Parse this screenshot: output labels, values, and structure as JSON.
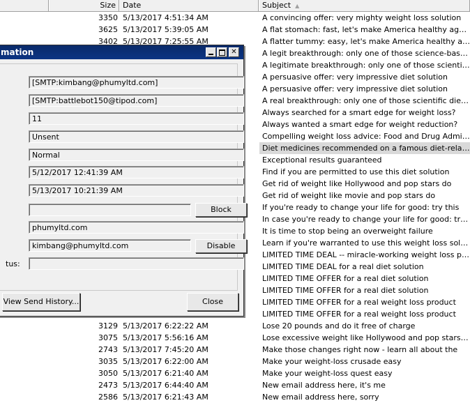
{
  "list": {
    "columns": {
      "size": "Size",
      "date": "Date",
      "subject": "Subject"
    },
    "rows": [
      {
        "size": "3350",
        "date": "5/13/2017 4:51:34 AM",
        "subject": "A convincing offer: very mighty weight loss solution"
      },
      {
        "size": "3625",
        "date": "5/13/2017 5:39:05 AM",
        "subject": "A flat stomach: fast, let's make America healthy again"
      },
      {
        "size": "3402",
        "date": "5/13/2017 7:25:55 AM",
        "subject": "A flatter tummy: easy, let's make America healthy again"
      },
      {
        "size": "",
        "date": "",
        "subject": "A legit breakthrough: only one of those science-based weig..."
      },
      {
        "size": "",
        "date": "",
        "subject": "A legitimate breakthrough: only one of those scientific dietary"
      },
      {
        "size": "",
        "date": "",
        "subject": "A persuasive offer: very impressive diet solution"
      },
      {
        "size": "",
        "date": "",
        "subject": "A persuasive offer: very impressive diet solution"
      },
      {
        "size": "",
        "date": "",
        "subject": "A real breakthrough: only one of those scientific dietary sol..."
      },
      {
        "size": "",
        "date": "",
        "subject": "Always searched for a smart edge for weight loss?"
      },
      {
        "size": "",
        "date": "",
        "subject": "Always wanted a smart edge for weight reduction?"
      },
      {
        "size": "",
        "date": "",
        "subject": "Compelling weight loss advice: Food and Drug Administration"
      },
      {
        "size": "",
        "date": "",
        "subject": "Diet medicines  recommended on a famous diet-related talk..."
      },
      {
        "size": "",
        "date": "",
        "subject": "Exceptional results guaranteed"
      },
      {
        "size": "",
        "date": "",
        "subject": "Find if you are permitted to use this diet solution"
      },
      {
        "size": "",
        "date": "",
        "subject": "Get rid of weight like Hollywood and pop stars do"
      },
      {
        "size": "",
        "date": "",
        "subject": "Get rid of weight like movie and pop stars do"
      },
      {
        "size": "",
        "date": "",
        "subject": "If you're ready to change your life for good: try this"
      },
      {
        "size": "",
        "date": "",
        "subject": "In case you're ready to change your life for good: try this"
      },
      {
        "size": "",
        "date": "",
        "subject": "It is time to stop being an overweight failure"
      },
      {
        "size": "",
        "date": "",
        "subject": "Learn if you're warranted to use this weight loss solution"
      },
      {
        "size": "",
        "date": "",
        "subject": "LIMITED TIME DEAL -- miracle-working weight loss pills"
      },
      {
        "size": "",
        "date": "",
        "subject": "LIMITED TIME DEAL for a real diet solution"
      },
      {
        "size": "",
        "date": "",
        "subject": "LIMITED TIME OFFER for a real diet solution"
      },
      {
        "size": "",
        "date": "",
        "subject": "LIMITED TIME OFFER for a real diet solution"
      },
      {
        "size": "",
        "date": "",
        "subject": "LIMITED TIME OFFER for a real weight loss product"
      },
      {
        "size": "",
        "date": "",
        "subject": "LIMITED TIME OFFER for a real weight loss product"
      },
      {
        "size": "3129",
        "date": "5/13/2017 6:22:22 AM",
        "subject": "Lose 20 pounds and do it free of charge"
      },
      {
        "size": "3075",
        "date": "5/13/2017 5:56:16 AM",
        "subject": "Lose excessive weight like Hollywood and pop stars do"
      },
      {
        "size": "2743",
        "date": "5/13/2017 7:45:20 AM",
        "subject": "Make those changes right now - learn all about the"
      },
      {
        "size": "3035",
        "date": "5/13/2017 6:22:00 AM",
        "subject": "Make your weight-loss crusade easy"
      },
      {
        "size": "3050",
        "date": "5/13/2017 6:21:40 AM",
        "subject": "Make your weight-loss quest easy"
      },
      {
        "size": "2473",
        "date": "5/13/2017 6:44:40 AM",
        "subject": "New email address here, it's me"
      },
      {
        "size": "2586",
        "date": "5/13/2017 6:21:43 AM",
        "subject": "New email address here, sorry"
      }
    ]
  },
  "dialog": {
    "title": "mation",
    "fields": {
      "from": "[SMTP:kimbang@phumyltd.com]",
      "to": "[SMTP:battlebot150@tipod.com]",
      "count": "11",
      "state": "Unsent",
      "priority": "Normal",
      "created": "5/12/2017 12:41:39 AM",
      "modified": "5/13/2017 10:21:39 AM",
      "block_value": "",
      "domain": "phumyltd.com",
      "account": "kimbang@phumyltd.com",
      "status_value": ""
    },
    "labels": {
      "status": "tus:"
    },
    "buttons": {
      "block": "Block",
      "disable": "Disable",
      "history": "View Send History...",
      "close": "Close"
    }
  }
}
